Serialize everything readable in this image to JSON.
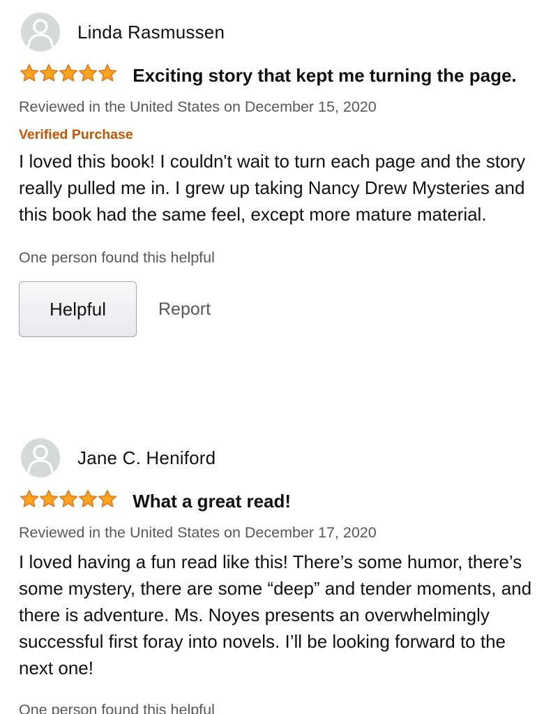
{
  "reviews": [
    {
      "reviewer": "Linda Rasmussen",
      "rating": 5,
      "title": "Exciting story that kept me turning the page.",
      "meta": "Reviewed in the United States on December 15, 2020",
      "verified": "Verified Purchase",
      "body": "I loved this book! I couldn't wait to turn each page and the story really pulled me in. I grew up taking Nancy Drew Mysteries and this book had the same feel, except more mature material.",
      "helpful_count": "One person found this helpful",
      "helpful_label": "Helpful",
      "report_label": "Report"
    },
    {
      "reviewer": "Jane C. Heniford",
      "rating": 5,
      "title": "What a great read!",
      "meta": "Reviewed in the United States on December 17, 2020",
      "body": "I loved having a fun read like this! There’s some humor, there’s some mystery, there are some “deep” and tender moments, and there is adventure. Ms. Noyes presents an overwhelmingly successful first foray into novels. I’ll be looking forward to the next one!",
      "helpful_count": "One person found this helpful"
    }
  ],
  "icons": {
    "avatar": "person-icon",
    "star": "star-icon"
  },
  "colors": {
    "star_fill": "#ffa41c",
    "star_stroke": "#de7921",
    "verified": "#c45500",
    "muted": "#565959",
    "avatar_bg": "#d5d9d9"
  }
}
